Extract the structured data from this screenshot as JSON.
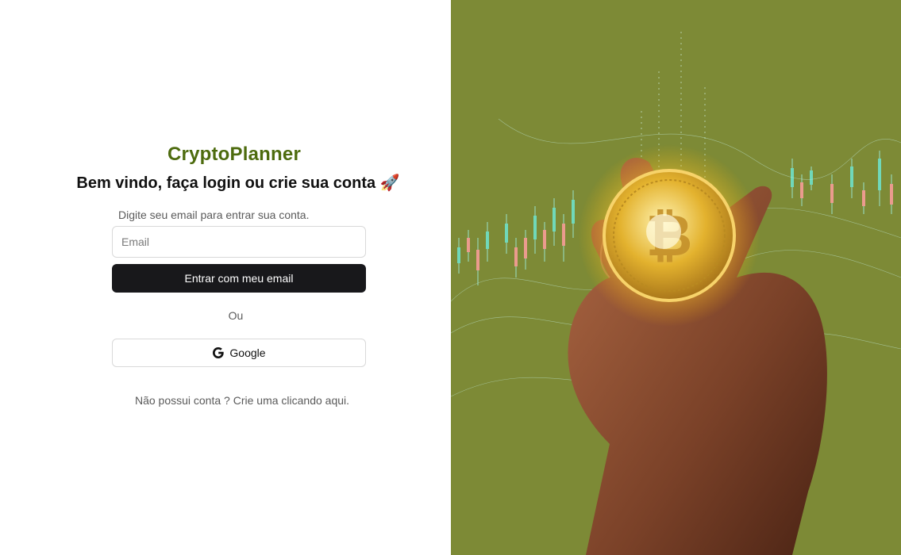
{
  "brand": {
    "name": "CryptoPlanner",
    "color": "#4d6b0e"
  },
  "login": {
    "welcome": "Bem vindo,  faça login ou crie sua conta 🚀",
    "hint": "Digite seu email para entrar sua conta.",
    "email_placeholder": "Email",
    "email_button": "Entrar com meu email",
    "or_label": "Ou",
    "google_button": "Google",
    "signup_prefix": "Não possui conta ?",
    "signup_link": "Crie uma clicando aqui."
  },
  "hero": {
    "background_color": "#7d8a36",
    "icons": [
      "bitcoin-coin-icon",
      "hand-illustration",
      "candlestick-chart-decoration"
    ]
  }
}
